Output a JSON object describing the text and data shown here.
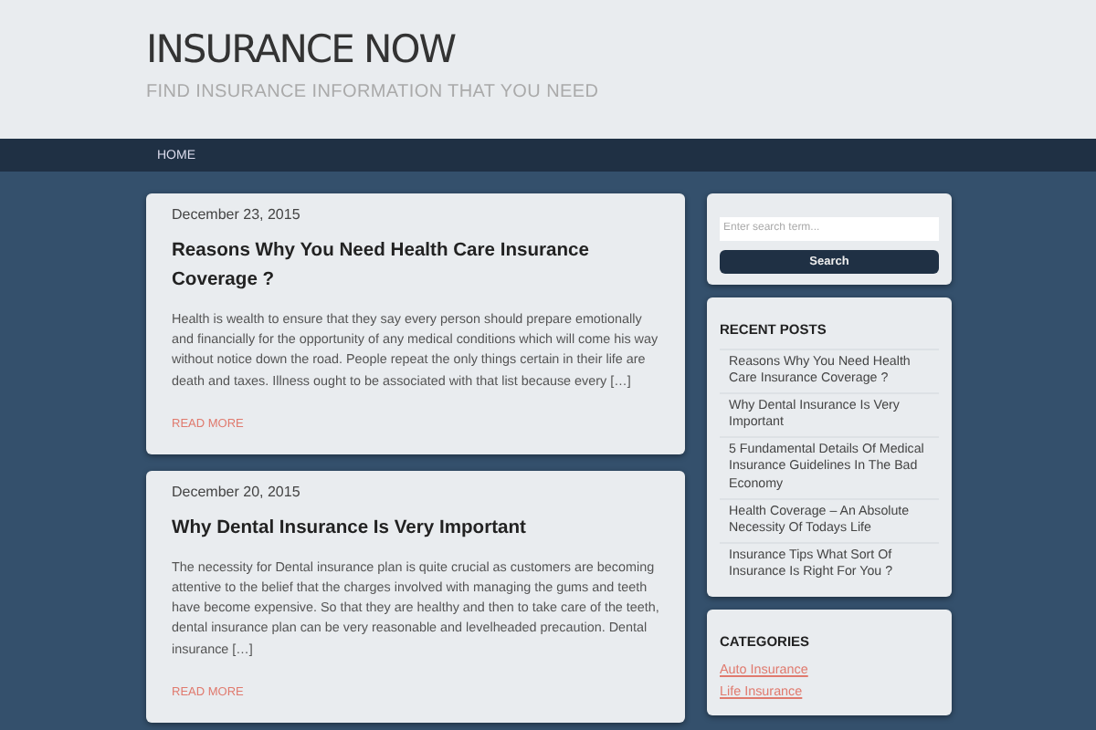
{
  "site": {
    "title": "INSURANCE NOW",
    "tagline": "FIND INSURANCE INFORMATION THAT YOU NEED"
  },
  "nav": [
    {
      "label": "HOME",
      "selected": true
    }
  ],
  "posts": [
    {
      "date": "December 23, 2015",
      "title": "Reasons Why You Need Health Care Insurance Coverage ?",
      "excerpt": "Health is wealth to ensure that they say every person should prepare emotionally and financially for the opportunity of any medical conditions which will come his way without notice down the road. People repeat the only things certain in their life are death and taxes. Illness ought to be associated with that list because every […]",
      "more": "READ MORE"
    },
    {
      "date": "December 20, 2015",
      "title": "Why Dental Insurance Is Very Important",
      "excerpt": "The necessity for Dental insurance plan is quite crucial as customers are becoming attentive to the belief that the charges involved with managing the gums and teeth have become expensive. So that they are healthy and then to take care of the teeth, dental insurance plan can be very reasonable and levelheaded precaution. Dental insurance […]",
      "more": "READ MORE"
    }
  ],
  "search": {
    "placeholder": "Enter search term...",
    "button": "Search"
  },
  "recent_posts": {
    "heading": "RECENT POSTS",
    "items": [
      "Reasons Why You Need Health Care Insurance Coverage ?",
      "Why Dental Insurance Is Very Important",
      "5 Fundamental Details Of Medical Insurance Guidelines In The Bad Economy",
      "Health Coverage – An Absolute Necessity Of Todays Life",
      "Insurance Tips What Sort Of Insurance Is Right For You ?"
    ]
  },
  "categories": {
    "heading": "CATEGORIES",
    "items": [
      "Auto Insurance",
      "Life Insurance"
    ]
  }
}
